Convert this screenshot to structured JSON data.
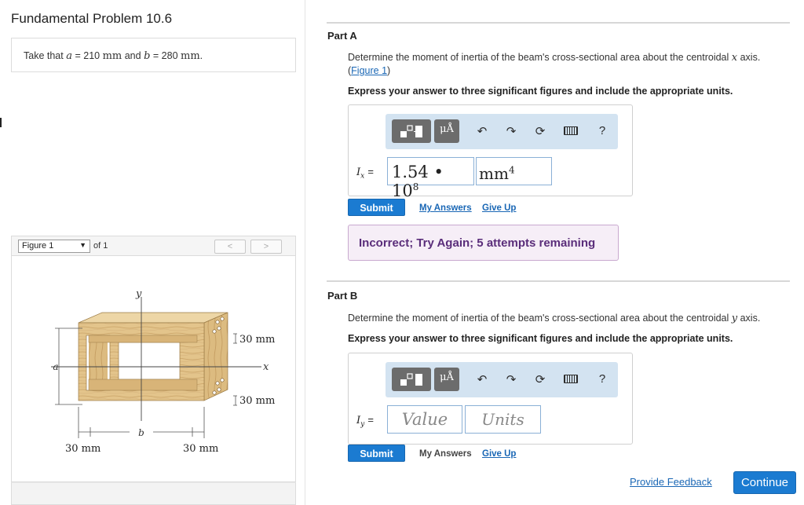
{
  "problem": {
    "title": "Fundamental Problem 10.6",
    "given_prefix": "Take that",
    "a_var": "a",
    "a_value": "= 210",
    "a_unit": "mm",
    "and_text": "and",
    "b_var": "b",
    "b_value": "= 280",
    "b_unit": "mm",
    "given_suffix": "."
  },
  "figure_nav": {
    "selected": "Figure 1",
    "of_text": "of 1",
    "prev": "<",
    "next": ">"
  },
  "figure": {
    "label_y": "y",
    "label_x": "x",
    "label_a": "a",
    "label_b": "b",
    "dim_top_right": "30 mm",
    "dim_bottom_right": "30 mm",
    "dim_left_bottom": "30 mm",
    "dim_right_bottom": "30 mm"
  },
  "part_a": {
    "title": "Part A",
    "question_pre": "Determine the moment of inertia of the beam's cross-sectional area about the centroidal",
    "question_axis": "x",
    "question_post": "axis.",
    "figure_link_open": "(",
    "figure_link": "Figure 1",
    "figure_link_close": ")",
    "instructions": "Express your answer to three significant figures and include the appropriate units.",
    "var_symbol": "I",
    "var_sub": "x",
    "eq": "=",
    "value_mantissa": "1.54",
    "value_dot": "•",
    "value_base": "10",
    "value_exp": "8",
    "unit_base": "mm",
    "unit_exp": "4",
    "submit": "Submit",
    "my_answers": "My Answers",
    "give_up": "Give Up",
    "feedback": "Incorrect; Try Again; 5 attempts remaining"
  },
  "part_b": {
    "title": "Part B",
    "question_pre": "Determine the moment of inertia of the beam's cross-sectional area about the centroidal",
    "question_axis": "y",
    "question_post": "axis.",
    "instructions": "Express your answer to three significant figures and include the appropriate units.",
    "var_symbol": "I",
    "var_sub": "y",
    "eq": "=",
    "value_placeholder": "Value",
    "units_placeholder": "Units",
    "submit": "Submit",
    "my_answers": "My Answers",
    "give_up": "Give Up"
  },
  "toolbar": {
    "units_glyph": "μÅ",
    "undo_icon": "undo-icon",
    "redo_icon": "redo-icon",
    "reset_icon": "reset-icon",
    "keyboard_icon": "keyboard-icon",
    "help": "?"
  },
  "footer": {
    "provide_feedback": "Provide Feedback",
    "continue": "Continue"
  },
  "colors": {
    "accent": "#1b7bd1",
    "link": "#1a67b5",
    "feedback_bg": "#f6eef7",
    "feedback_text": "#5a2d7a",
    "toolbar_bg": "#d3e3f1",
    "wood": "#e3c48b"
  }
}
